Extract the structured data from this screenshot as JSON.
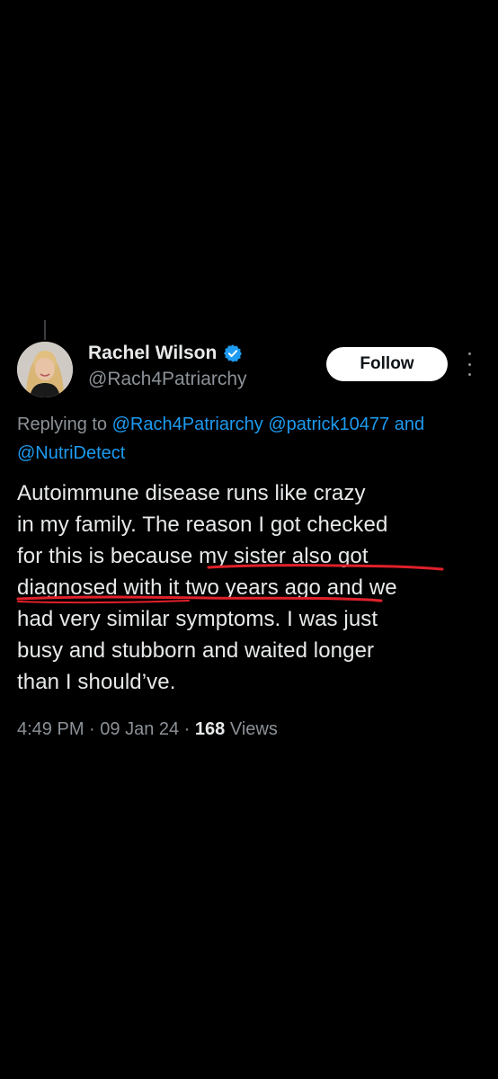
{
  "tweet": {
    "author": {
      "display_name": "Rachel Wilson",
      "handle": "@Rach4Patriarchy",
      "verified": true,
      "avatar_icon": "avatar-photo"
    },
    "follow_label": "Follow",
    "more_icon": "more-vertical-icon",
    "replying": {
      "prefix": "Replying to ",
      "mention_1": "@Rach4Patriarchy",
      "mention_2": "@patrick10477",
      "conjunction": "and",
      "mention_3": "@NutriDetect"
    },
    "body_lines": [
      "Autoimmune disease runs like crazy",
      "in my family. The reason I got checked",
      "for this is because my sister also got",
      "diagnosed with it two years ago and we",
      "had very similar symptoms. I was just",
      "busy and stubborn and waited longer",
      "than I should’ve."
    ],
    "meta": {
      "time": "4:49 PM",
      "separator": " · ",
      "date": "09 Jan 24",
      "views_count": "168",
      "views_label": "Views"
    }
  },
  "colors": {
    "background": "#000000",
    "text": "#e7e9ea",
    "secondary_text": "#8b9197",
    "link": "#1d9bf0",
    "verified_badge": "#1d9bf0",
    "underline_annotation": "#e0202a"
  }
}
